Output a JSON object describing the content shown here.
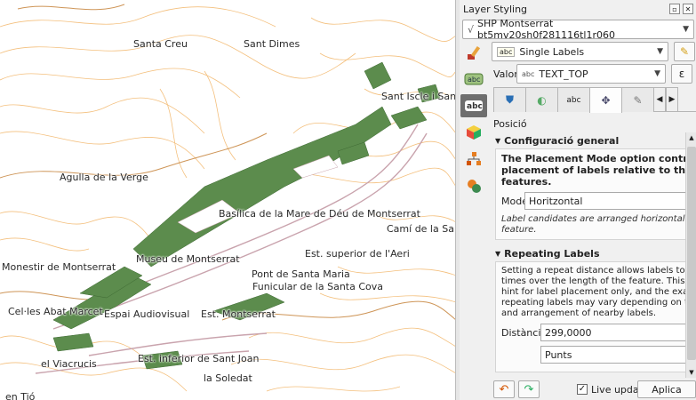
{
  "panel": {
    "title": "Layer Styling",
    "layer": "SHP Montserrat bt5mv20sh0f281116tl1r060",
    "label_mode": "Single Labels",
    "value_label": "Valor",
    "value_field": "TEXT_TOP",
    "section_caption": "Posició",
    "general_group": "Configuració general",
    "general_desc": [
      "The Placement Mode option controls the o",
      "placement of labels relative to their corre",
      "features."
    ],
    "mode_label": "Mode",
    "mode_value": "Horitzontal",
    "mode_hint": [
      "Label candidates are arranged horizontally along",
      "feature."
    ],
    "repeat_group": "Repeating Labels",
    "repeat_desc": [
      "Setting a repeat distance allows labels to be repe",
      "times over the length of the feature. This distanc",
      "hint for label placement only, and the exact dista",
      "repeating labels may vary depending on the shap",
      "and arrangement of nearby labels."
    ],
    "distance_label": "Distància",
    "distance_value": "299,0000",
    "unit_value": "Punts",
    "live_update": "Live update",
    "apply": "Aplica"
  },
  "map_labels": [
    "Santa Creu",
    "Sant Dimes",
    "Sant Iscle i Santa",
    "Agulla de la Verge",
    "Basílica de la Mare de Déu de Montserrat",
    "Camí de la Santa",
    "Monestir de Montserrat",
    "Museu de Montserrat",
    "Est. superior de l'Aeri",
    "Pont de Santa Maria",
    "Funicular de la Santa Cova",
    "Cel·les Abat Marcet",
    "Espai Audiovisual",
    "Est. Montserrat",
    "el Viacrucis",
    "Est. inferior de Sant Joan",
    "la Soledat",
    "en Tió"
  ],
  "colors": {
    "contour": "#f2b567",
    "terrain_line": "#c98a45",
    "building": "#5c8c4d",
    "road": "#c9a3ad",
    "active_sidebar": "#6e6e6e"
  }
}
